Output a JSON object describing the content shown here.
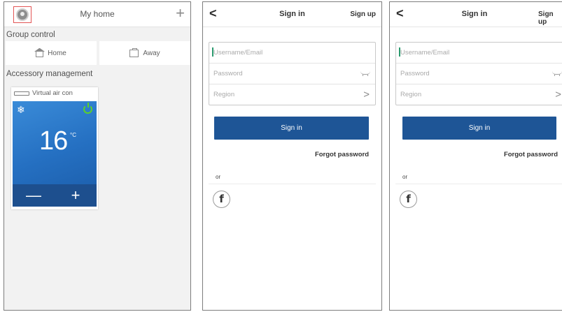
{
  "home": {
    "title": "My home",
    "group_control": "Group control",
    "modes": [
      {
        "label": "Home",
        "icon": "home-icon"
      },
      {
        "label": "Away",
        "icon": "away-icon"
      }
    ],
    "accessory_management": "Accessory management",
    "device": {
      "name": "Virtual air con",
      "temperature": "16",
      "unit": "°C",
      "minus": "—",
      "plus": "+",
      "mode_icon": "snowflake-icon",
      "power_color": "#5bd12a"
    },
    "add_symbol": "+"
  },
  "signin_screens": [
    {
      "back": "<",
      "title": "Sign in",
      "signup": "Sign up",
      "username_placeholder": "Username/Email",
      "password_placeholder": "Password",
      "region_placeholder": "Region",
      "button": "Sign in",
      "forgot": "Forgot password",
      "or": "or",
      "facebook": "f"
    },
    {
      "back": "<",
      "title": "Sign in",
      "signup": "Sign up",
      "username_placeholder": "Username/Email",
      "password_placeholder": "Password",
      "region_placeholder": "Region",
      "button": "Sign in",
      "forgot": "Forgot password",
      "or": "or",
      "facebook": "f"
    }
  ],
  "colors": {
    "accent_blue": "#1e5596",
    "card_blue": "#2570c2",
    "avatar_highlight": "#e25555"
  }
}
